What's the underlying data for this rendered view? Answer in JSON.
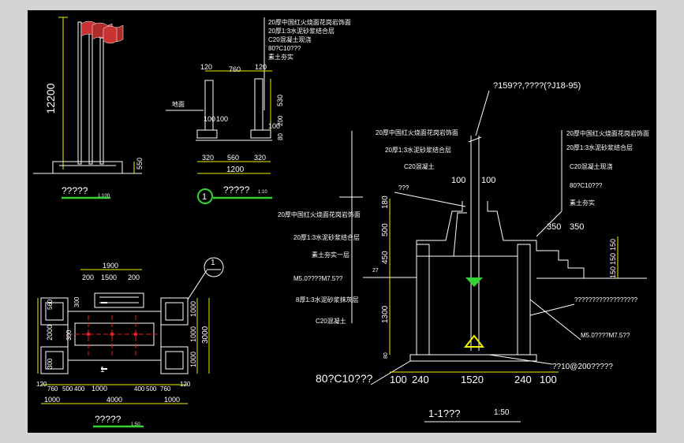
{
  "colors": {
    "background": "#000000",
    "frame_outer": "#d4d4d4",
    "lines": "#ffffff",
    "dimensions": "#35d235",
    "accent": "#f2f200",
    "flag": "#c83232"
  },
  "elevation_view": {
    "height_dim": "12200",
    "base_dim": "550",
    "caption": "?????",
    "scale": "1:100"
  },
  "top_detail": {
    "notes": [
      "20厚中国红火烧面花岗岩饰面",
      "20厚1:3水泥砂浆结合层",
      "C20混凝土现浇",
      "80?C10???",
      "素土夯实"
    ],
    "dims_top": [
      "120",
      "760",
      "120"
    ],
    "dims_bottom": [
      "320",
      "560",
      "320"
    ],
    "total": "1200",
    "left_label": "地面",
    "dim_100a": "100",
    "dim_100b": "100",
    "dim_530": "530",
    "dim_100c": "100",
    "dim_80": "80",
    "dim_200": "200",
    "caption": "?????",
    "scale": "1:10",
    "marker": "1"
  },
  "plan_view": {
    "dims_top": [
      "1900",
      "200",
      "1500",
      "200"
    ],
    "dims_left": [
      "560",
      "300",
      "2000",
      "300",
      "300"
    ],
    "dims_right": [
      "1000",
      "1000",
      "1000",
      "3000"
    ],
    "dims_bottom_row1": [
      "120",
      "760",
      "500",
      "400",
      "1000",
      "400",
      "500",
      "760",
      "120"
    ],
    "dims_bottom_row2": [
      "1000",
      "4000",
      "1000"
    ],
    "caption": "?????",
    "scale": "1:50",
    "marker": "1",
    "section_mark": "1"
  },
  "section_view": {
    "pipe_note": "?159??,????(?J18-95)",
    "notes_left": [
      "20厚中国红火烧面花岗岩饰面",
      "20厚1:3水泥砂浆结合层",
      "C20混凝土",
      "???",
      "20厚中国红火烧面花岗岩饰面",
      "20厚1:3水泥砂浆结合层",
      "素土夯实一层",
      "M5.0????M7.5??",
      "8厚1:3水泥砂浆抹灰层",
      "C20混凝土"
    ],
    "notes_right": [
      "20厚中国红火烧面花岗岩饰面",
      "20厚1:3水泥砂浆结合层",
      "C20混凝土现浇",
      "80?C10???",
      "素土夯实"
    ],
    "dims_vertical": [
      "180",
      "500",
      "450",
      "1300",
      "80"
    ],
    "dims_collar": [
      "100",
      "100"
    ],
    "dims_step": [
      "350",
      "350"
    ],
    "dims_step_vertical": [
      "150",
      "150",
      "150"
    ],
    "dims_bottom": [
      "100",
      "240",
      "1520",
      "240",
      "100"
    ],
    "note_foundation": "80?C10???",
    "note_wall": "??????????????????",
    "note_mortar": "M5.0????M7.5??",
    "note_bottom": "??10@200?????",
    "dim_27": "27",
    "caption": "1-1???",
    "scale": "1:50"
  }
}
